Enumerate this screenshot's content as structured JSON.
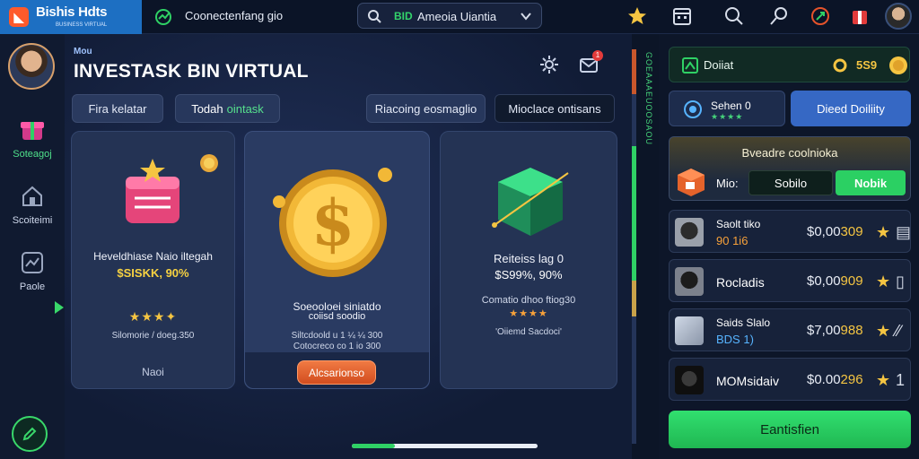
{
  "app": {
    "title": "Bishis Hdts",
    "subtitle": "BUSINESS VIRTUAL",
    "connection_text": "Coonectenfang gio"
  },
  "search": {
    "badge": "BID",
    "value": "Ameoia Uiantia"
  },
  "nav": {
    "items": [
      {
        "label": "Soteagoj",
        "icon": "gift-box-icon",
        "active": true
      },
      {
        "label": "Scoiteimi",
        "icon": "home-icon",
        "active": false
      },
      {
        "label": "Paole",
        "icon": "chart-icon",
        "active": false
      }
    ]
  },
  "main": {
    "kicker": "Mou",
    "title": "INVESTASK BIN VIRTUAL",
    "notification_count": "1",
    "chips": {
      "filter1": "Fira kelatar",
      "filter2_prefix": "Todah",
      "filter2_highlight": "ointask",
      "filter3": "Riacoing eosmaglio",
      "filter4": "Mioclace ontisans"
    },
    "cards": [
      {
        "name": "Heveldhiase Naio iltegah",
        "price": "$SISKK, 90%",
        "stars": "★★★✦",
        "sub": "Silomorie / doeg.350",
        "foot": "Naoi"
      },
      {
        "name": "Soeooloei siniatdo",
        "name2": "coiisd soodio",
        "sub": "Siltcdoold u 1 ¼ ¼ 300",
        "sub2": "Cotocreco co 1 io 300",
        "action": "Alcsarionso"
      },
      {
        "name": "Reiteiss lag 0",
        "price": "$S99%, 90%",
        "sub": "Comatio dhoo ftiog30",
        "stars": "★★★★",
        "sub2": "'Oiiemd Sacdoci'"
      }
    ],
    "progress": 0.23
  },
  "splitter": {
    "vertical_text": "GOEAAAEUOOSAOU"
  },
  "right": {
    "wallet_label": "Doiiat",
    "wallet_value": "5S9",
    "user_name": "Sehen 0",
    "user_stars": "★★★★",
    "daily_button": "Dieed Doiliity",
    "offer": {
      "title": "Bveadre coolnioka",
      "label": "Mio:",
      "field_value": "Sobilo",
      "button": "Nobik"
    },
    "list": [
      {
        "name": "Saolt tiko",
        "sub": "90 1i6",
        "price_prefix": "$0,00",
        "price_suffix": "309",
        "icon": "★",
        "action": "▤",
        "sub_color": "orange"
      },
      {
        "name": "Rocladis",
        "sub": "",
        "price_prefix": "$0,00",
        "price_suffix": "909",
        "icon": "★",
        "action": "▯",
        "sub_color": "none"
      },
      {
        "name": "Saids Slalo",
        "sub": "BDS 1)",
        "price_prefix": "$7,00",
        "price_suffix": "988",
        "icon": "★",
        "action": "⁄∕",
        "sub_color": "blue"
      },
      {
        "name": "MOMsidaiv",
        "sub": "",
        "price_prefix": "$0.00",
        "price_suffix": "296",
        "icon": "★",
        "action": "1",
        "sub_color": "none"
      }
    ],
    "cta": "Eantisfien"
  },
  "colors": {
    "accent_green": "#2bd063",
    "accent_gold": "#f5c542",
    "accent_orange": "#e0612c",
    "panel_bg": "#0d1629"
  }
}
